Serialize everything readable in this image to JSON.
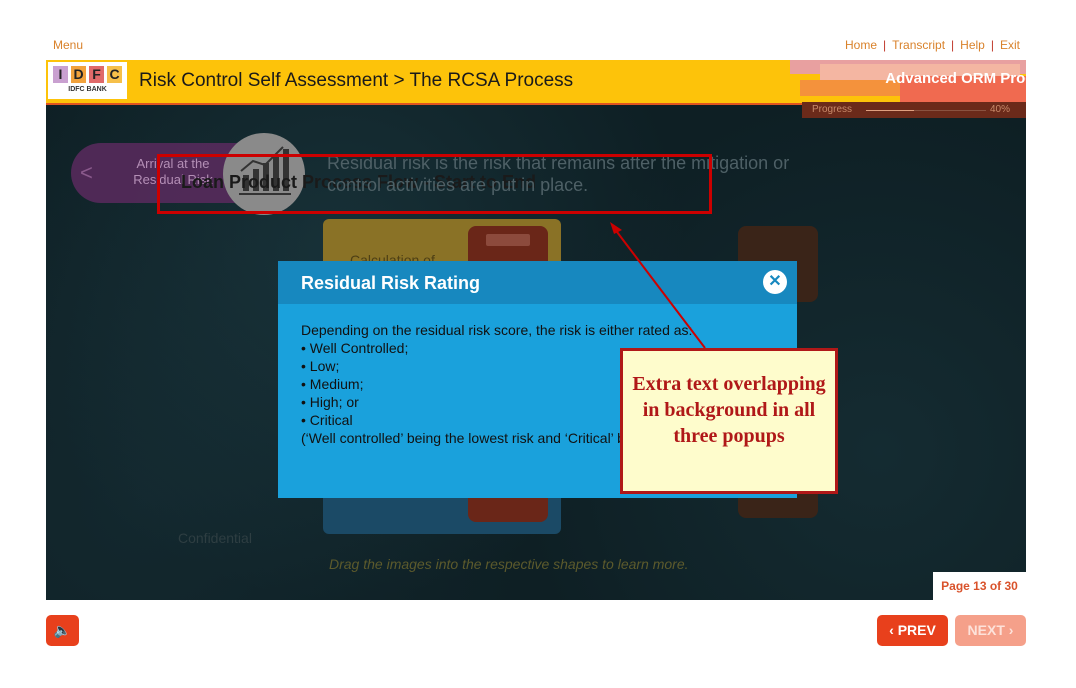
{
  "nav": {
    "menu": "Menu",
    "links": [
      "Home",
      "Transcript",
      "Help",
      "Exit"
    ],
    "separator": "|"
  },
  "header": {
    "logo_letters": [
      "I",
      "D",
      "F",
      "C"
    ],
    "logo_subtitle": "IDFC BANK",
    "title": "Risk Control Self Assessment > The RCSA Process",
    "program": "Advanced ORM Program"
  },
  "progress": {
    "label": "Progress",
    "percent_text": "40%",
    "value": 0.4
  },
  "stage": {
    "pill_arrow": "<",
    "pill_label": "Arrival at the Residual Risk",
    "loan_title": "Loan Product Process Flow - Start to End",
    "residual_text": "Residual risk is the risk that remains after the mitigation or control activities are put in place.",
    "tile_label": "Calculation of",
    "confidential": "Confidential",
    "drag_hint": "Drag the images into the respective shapes to learn more."
  },
  "modal": {
    "title": "Residual Risk Rating",
    "close_glyph": "✕",
    "intro": "Depending on the residual risk score, the risk is either rated as:",
    "items": [
      "Well Controlled;",
      "Low;",
      "Medium;",
      "High; or",
      "Critical"
    ],
    "outro": "(‘Well controlled’ being the lowest risk and ‘Critical’ being the highest risk)."
  },
  "callout": {
    "text": "Extra text overlapping in background in all three popups"
  },
  "footer": {
    "page": "Page 13 of 30",
    "audio_glyph": "🔈",
    "prev": "‹ PREV",
    "next": "NEXT ›"
  },
  "colors": {
    "header_yellow": "#fdc30a",
    "accent_orange": "#e8401c",
    "modal_blue": "#1aa1dc",
    "callout_red": "#b01818"
  }
}
